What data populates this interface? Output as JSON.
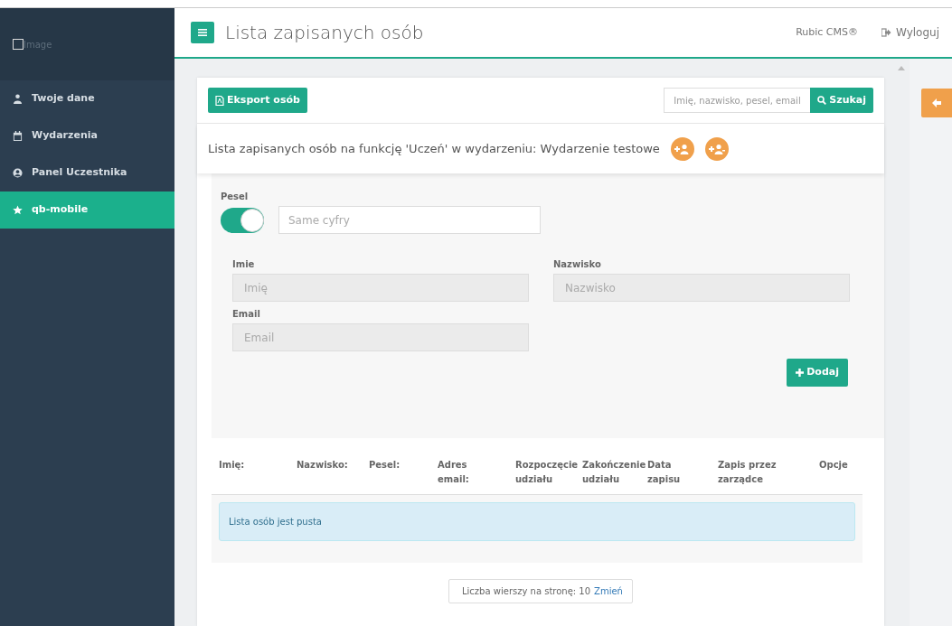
{
  "sidebar": {
    "logo_alt": "Image",
    "items": [
      {
        "label": "Twoje dane",
        "selected": false
      },
      {
        "label": "Wydarzenia",
        "selected": false
      },
      {
        "label": "Panel Uczestnika",
        "selected": false
      },
      {
        "label": "qb-mobile",
        "selected": true
      }
    ]
  },
  "header": {
    "title": "Lista zapisanych osób",
    "brand": "Rubic CMS®",
    "logout": "Wyloguj"
  },
  "toolbar": {
    "export_button": "Eksport osób",
    "search": {
      "placeholder": "Imię, nazwisko, pesel, email"
    },
    "search_button": "Szukaj"
  },
  "heading": "Lista zapisanych osób na funkcję 'Uczeń' w wydarzeniu: Wydarzenie testowe",
  "form": {
    "pesel": {
      "label": "Pesel",
      "on": true,
      "placeholder": "Same cyfry"
    },
    "fields": [
      {
        "label": "Imie",
        "placeholder": "Imię"
      },
      {
        "label": "Nazwisko",
        "placeholder": "Nazwisko"
      },
      {
        "label": "Email",
        "placeholder": "Email"
      }
    ],
    "add_button": "Dodaj"
  },
  "table": {
    "columns": [
      [
        "Imię:"
      ],
      [
        "Nazwisko:"
      ],
      [
        "Pesel:"
      ],
      [
        "Adres",
        "email:"
      ],
      [
        "Rozpoczęcie",
        "udziału"
      ],
      [
        "Zakończenie",
        "udziału"
      ],
      [
        "Data",
        "zapisu"
      ],
      [
        "Zapis przez",
        "zarządce"
      ],
      [
        "Opcje"
      ]
    ],
    "empty_message": "Lista osób jest pusta"
  },
  "pager": {
    "text": "Liczba wierszy na stronę: 10",
    "link": "Zmień"
  }
}
